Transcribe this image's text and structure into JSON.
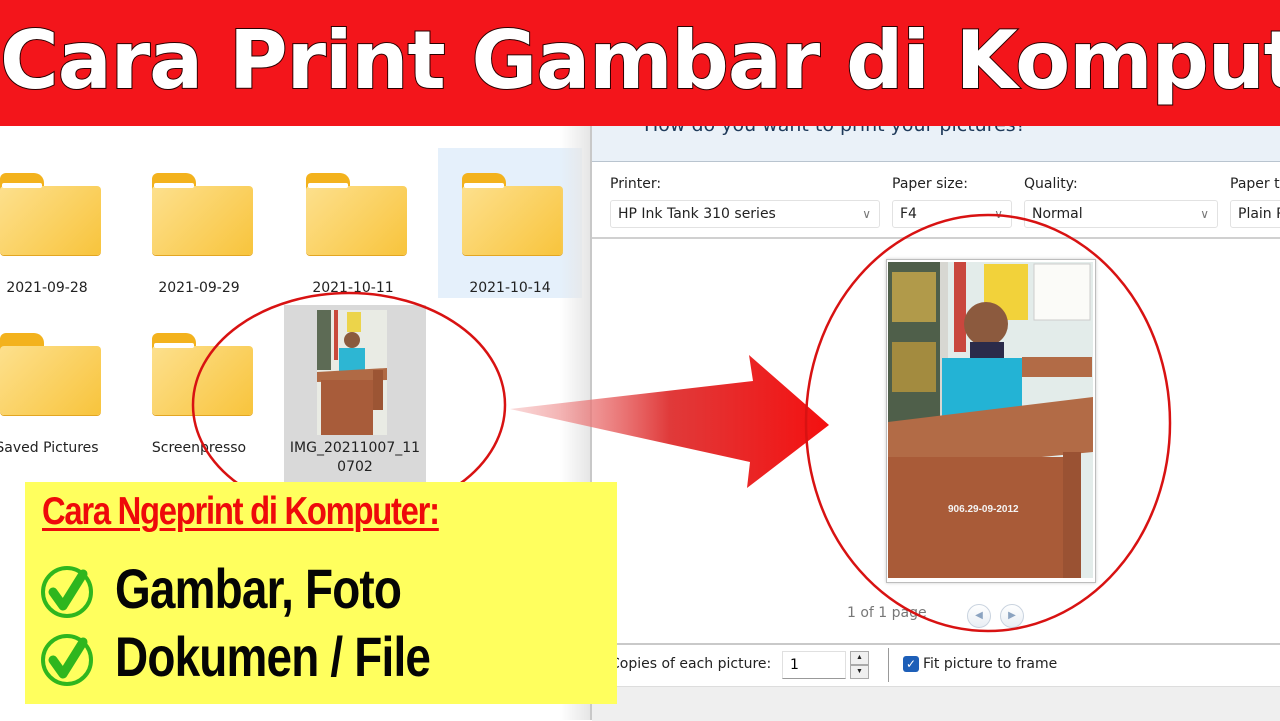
{
  "banner": {
    "title": "Cara Print Gambar di Komputer"
  },
  "explorer": {
    "folders": [
      {
        "label": "2021-09-28",
        "selected": false
      },
      {
        "label": "2021-09-29",
        "selected": false
      },
      {
        "label": "2021-10-11",
        "selected": false
      },
      {
        "label": "2021-10-14",
        "selected": true
      },
      {
        "label": "Saved Pictures",
        "selected": false
      },
      {
        "label": "Screenpresso",
        "selected": false
      }
    ],
    "image_file": {
      "label_line1": "IMG_20211007_11",
      "label_line2": "0702",
      "icon": "image-thumbnail"
    }
  },
  "print_dialog": {
    "question": "How do you want to print your pictures?",
    "printer": {
      "label": "Printer:",
      "value": "HP Ink Tank 310 series"
    },
    "paper_size": {
      "label": "Paper size:",
      "value": "F4"
    },
    "quality": {
      "label": "Quality:",
      "value": "Normal"
    },
    "paper_type": {
      "label": "Paper type:",
      "value": "Plain Paper"
    },
    "page_count": "1 of 1 page",
    "prev_icon": "triangle-left",
    "next_icon": "triangle-right",
    "copies": {
      "label": "Copies of each picture:",
      "value": "1"
    },
    "spin_up": "▲",
    "spin_down": "▼",
    "fit_picture": {
      "label": "Fit picture to frame",
      "checked": true
    }
  },
  "callout": {
    "heading": "Cara Ngeprint di Komputer:",
    "items": [
      {
        "text": "Gambar, Foto",
        "icon": "check-circle"
      },
      {
        "text": "Dokumen / File",
        "icon": "check-circle"
      }
    ]
  },
  "colors": {
    "banner_red": "#f3151b",
    "callout_yellow": "#ffff5e",
    "heading_red": "#ee0a0a",
    "check_green": "#2fb61e",
    "folder_yellow": "#f8c43c",
    "selection_blue": "#e5f0fb",
    "checkbox_blue": "#1d5fb8"
  }
}
